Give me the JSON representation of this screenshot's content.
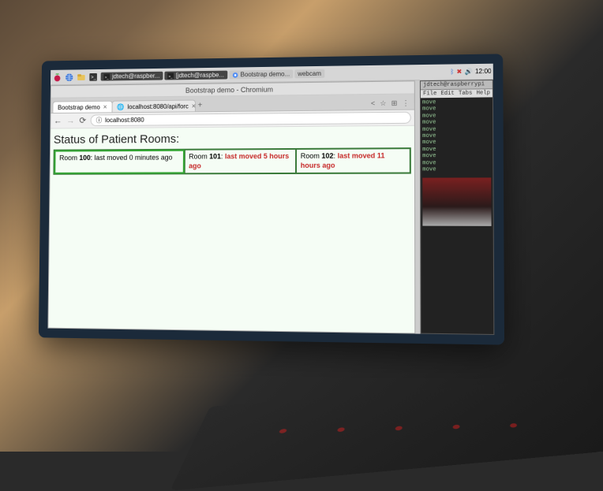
{
  "taskbar": {
    "items": [
      {
        "label": "jdtech@raspber..."
      },
      {
        "label": "[jdtech@raspbe..."
      },
      {
        "label": "Bootstrap demo..."
      },
      {
        "label": "webcam"
      }
    ],
    "clock": "12:00"
  },
  "terminal": {
    "title": "jdtech@raspberrypi",
    "menu": [
      "File",
      "Edit",
      "Tabs",
      "Help"
    ],
    "lines": [
      "move",
      "move",
      "move",
      "move",
      "move",
      "move",
      "move",
      "move",
      "move",
      "move",
      "move"
    ]
  },
  "browser": {
    "title": "Bootstrap demo - Chromium",
    "tabs": [
      {
        "label": "Bootstrap demo",
        "active": true
      },
      {
        "label": "localhost:8080/api/forc",
        "active": false
      }
    ],
    "nav": {
      "back": "←",
      "forward": "→",
      "reload": "⟳",
      "info": "ⓘ",
      "url": "localhost:8080",
      "share": "<",
      "star": "☆",
      "ext": "⊞",
      "menu": "⋮"
    },
    "page": {
      "heading": "Status of Patient Rooms:",
      "rooms": [
        {
          "label_pre": "Room ",
          "num": "100",
          "after": ": last moved 0 minutes ago",
          "danger": false
        },
        {
          "label_pre": "Room ",
          "num": "101",
          "after_pre": ": ",
          "danger_text": "last moved 5 hours ago",
          "danger": true
        },
        {
          "label_pre": "Room ",
          "num": "102",
          "after_pre": ": ",
          "danger_text": "last moved 11 hours ago",
          "danger": true
        }
      ]
    }
  }
}
